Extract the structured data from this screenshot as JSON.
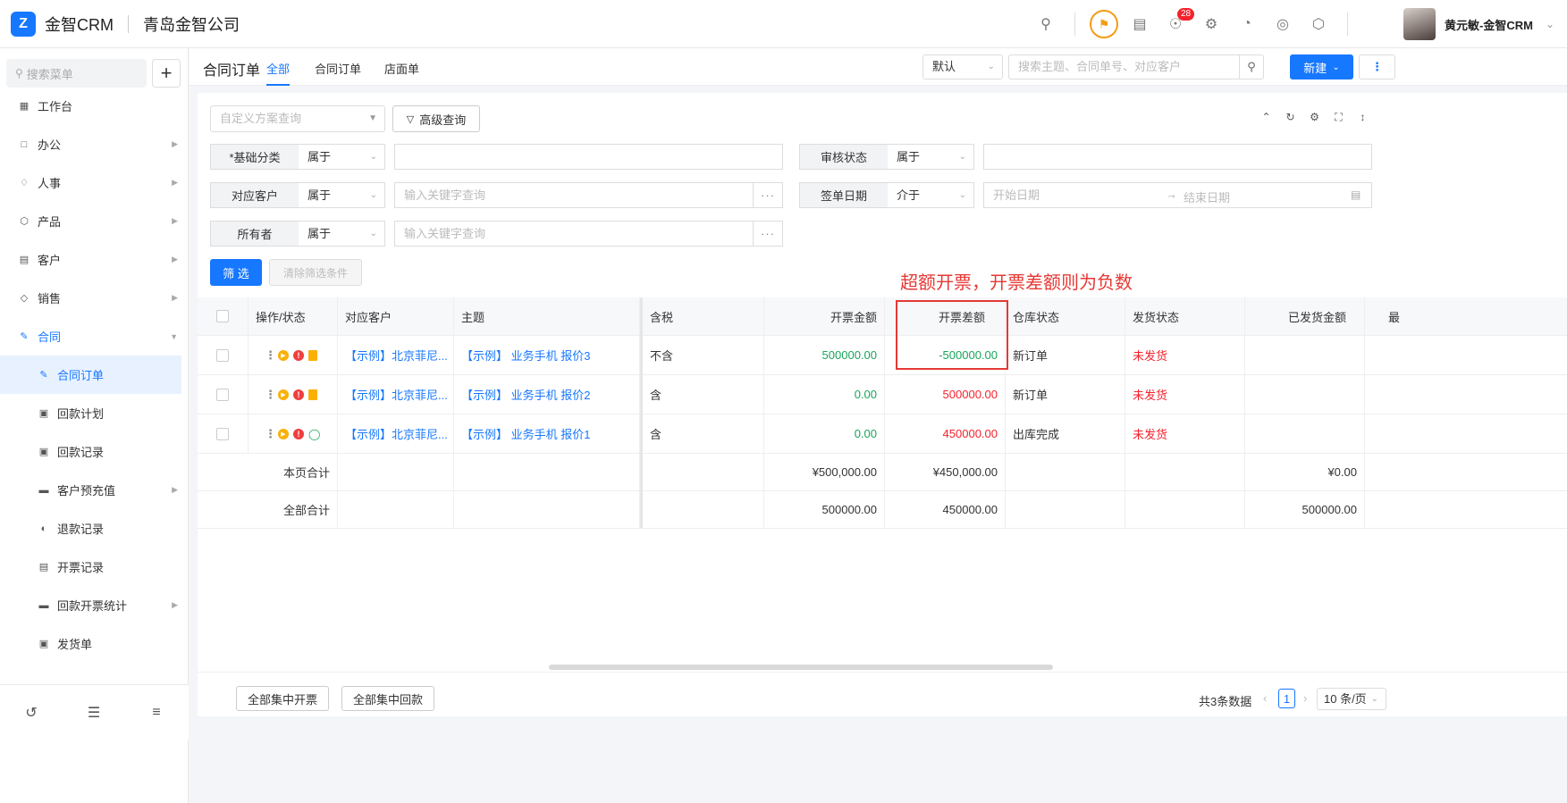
{
  "header": {
    "brand": "金智CRM",
    "company": "青岛金智公司",
    "notification_count": "28",
    "username": "黄元敏-金智CRM"
  },
  "sidebar": {
    "search_placeholder": "搜索菜单",
    "items": [
      {
        "label": "工作台",
        "icon": "dashboard-icon"
      },
      {
        "label": "办公",
        "icon": "office-icon"
      },
      {
        "label": "人事",
        "icon": "hr-icon"
      },
      {
        "label": "产品",
        "icon": "product-icon"
      },
      {
        "label": "客户",
        "icon": "customer-icon"
      },
      {
        "label": "销售",
        "icon": "sales-icon"
      },
      {
        "label": "合同",
        "icon": "contract-icon"
      }
    ],
    "sub_items": [
      {
        "label": "合同订单"
      },
      {
        "label": "回款计划"
      },
      {
        "label": "回款记录"
      },
      {
        "label": "客户预充值"
      },
      {
        "label": "退款记录"
      },
      {
        "label": "开票记录"
      },
      {
        "label": "回款开票统计"
      },
      {
        "label": "发货单"
      }
    ]
  },
  "page": {
    "title": "合同订单",
    "tabs": [
      "全部",
      "合同订单",
      "店面单"
    ],
    "view_select": "默认",
    "search_placeholder": "搜索主题、合同单号、对应客户",
    "new_label": "新建"
  },
  "filters": {
    "scheme_placeholder": "自定义方案查询",
    "advanced_label": "高级查询",
    "rows": [
      {
        "label": "*基础分类",
        "op": "属于",
        "placeholder": ""
      },
      {
        "label": "审核状态",
        "op": "属于",
        "placeholder": ""
      },
      {
        "label": "对应客户",
        "op": "属于",
        "placeholder": "输入关键字查询"
      },
      {
        "label": "签单日期",
        "op": "介于",
        "start": "开始日期",
        "end": "结束日期"
      },
      {
        "label": "所有者",
        "op": "属于",
        "placeholder": "输入关键字查询"
      }
    ],
    "dots": "···",
    "filter_btn": "筛 选",
    "clear_btn": "清除筛选条件"
  },
  "annotation": "超额开票，开票差额则为负数",
  "table": {
    "columns": [
      "操作/状态",
      "对应客户",
      "主题",
      "含税",
      "开票金额",
      "开票差额",
      "仓库状态",
      "发货状态",
      "已发货金额",
      "最"
    ],
    "rows": [
      {
        "customer": "【示例】北京菲尼...",
        "subject": "【示例】 业务手机 报价3",
        "tax": "不含",
        "invoice": "500000.00",
        "diff": "-500000.00",
        "warehouse": "新订单",
        "ship": "未发货"
      },
      {
        "customer": "【示例】北京菲尼...",
        "subject": "【示例】 业务手机 报价2",
        "tax": "含",
        "invoice": "0.00",
        "diff": "500000.00",
        "warehouse": "新订单",
        "ship": "未发货"
      },
      {
        "customer": "【示例】北京菲尼...",
        "subject": "【示例】 业务手机 报价1",
        "tax": "含",
        "invoice": "0.00",
        "diff": "450000.00",
        "warehouse": "出库完成",
        "ship": "未发货"
      }
    ],
    "page_total": {
      "label": "本页合计",
      "invoice": "¥500,000.00",
      "diff": "¥450,000.00",
      "shipped": "¥0.00"
    },
    "all_total": {
      "label": "全部合计",
      "invoice": "500000.00",
      "diff": "450000.00",
      "shipped": "500000.00"
    }
  },
  "footer": {
    "batch_invoice": "全部集中开票",
    "batch_payment": "全部集中回款",
    "total": "共3条数据",
    "page": "1",
    "page_size": "10 条/页"
  },
  "colors": {
    "accent": "#1677ff",
    "positive": "#19a55b",
    "negative": "#f5222d"
  }
}
